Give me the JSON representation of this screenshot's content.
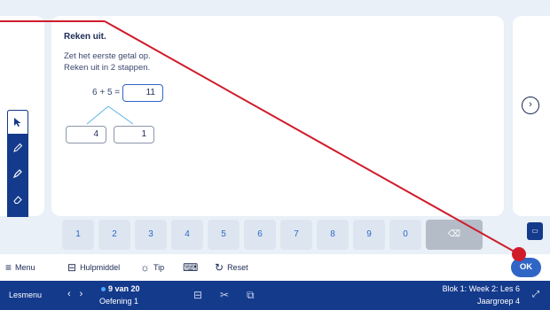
{
  "question": {
    "title": "Reken uit.",
    "instruction_line1": "Zet het eerste getal op.",
    "instruction_line2": "Reken uit in 2 stappen.",
    "equation": "6 + 5 =",
    "answer": "11",
    "split_left": "4",
    "split_right": "1"
  },
  "toolbar": {
    "pointer_icon": "pointer-icon",
    "pencil_icon": "pencil-icon",
    "marker_icon": "marker-icon",
    "eraser_icon": "eraser-icon",
    "collapse_icon": "collapse-icon"
  },
  "keypad": {
    "keys": [
      "1",
      "2",
      "3",
      "4",
      "5",
      "6",
      "7",
      "8",
      "9",
      "0"
    ]
  },
  "actions": {
    "menu": "Menu",
    "hulpmiddel": "Hulpmiddel",
    "tip": "Tip",
    "reset": "Reset",
    "ok": "OK"
  },
  "status": {
    "lesmenu": "Lesmenu",
    "progress": "9 van 20",
    "oefening": "Oefening 1",
    "blok": "Blok 1: Week 2: Les 6",
    "jaargroep": "Jaargroep 4"
  },
  "colors": {
    "brand_blue": "#143a8c",
    "accent_blue": "#2f66c6",
    "annotation_red": "#d01c2a"
  }
}
